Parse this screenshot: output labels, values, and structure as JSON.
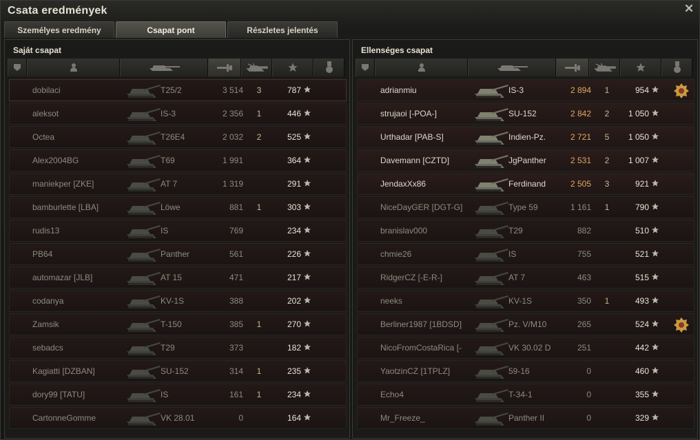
{
  "window": {
    "title": "Csata eredmények"
  },
  "tabs": [
    {
      "label": "Személyes eredmény",
      "active": false
    },
    {
      "label": "Csapat pont",
      "active": true
    },
    {
      "label": "Részletes jelentés",
      "active": false
    }
  ],
  "icons": {
    "close": "close-icon",
    "columns": [
      "tier-icon",
      "player-icon",
      "tank-icon",
      "damage-icon",
      "kills-icon",
      "xp-star-icon",
      "medal-icon"
    ]
  },
  "colors": {
    "accent": "#e0a860",
    "alive_text": "#dedad0",
    "dead_text": "#8e8a80",
    "row_bg": "#2a1c1a"
  },
  "teams": [
    {
      "title": "Saját csapat",
      "players": [
        {
          "name": "dobilaci",
          "tank": "T25/2",
          "damage": "3 514",
          "kills": "3",
          "xp": "787",
          "alive": false,
          "self": true,
          "medal": ""
        },
        {
          "name": "aleksot",
          "tank": "IS-3",
          "damage": "2 356",
          "kills": "1",
          "xp": "446",
          "alive": false,
          "self": false,
          "medal": ""
        },
        {
          "name": "Octea",
          "tank": "T26E4",
          "damage": "2 032",
          "kills": "2",
          "xp": "525",
          "alive": false,
          "self": false,
          "medal": ""
        },
        {
          "name": "Alex2004BG",
          "tank": "T69",
          "damage": "1 991",
          "kills": "",
          "xp": "364",
          "alive": false,
          "self": false,
          "medal": ""
        },
        {
          "name": "maniekper [ZKE]",
          "tank": "AT 7",
          "damage": "1 319",
          "kills": "",
          "xp": "291",
          "alive": false,
          "self": false,
          "medal": ""
        },
        {
          "name": "bamburlette [LBA]",
          "tank": "Löwe",
          "damage": "881",
          "kills": "1",
          "xp": "303",
          "alive": false,
          "self": false,
          "medal": ""
        },
        {
          "name": "rudis13",
          "tank": "IS",
          "damage": "769",
          "kills": "",
          "xp": "234",
          "alive": false,
          "self": false,
          "medal": ""
        },
        {
          "name": "PB64",
          "tank": "Panther",
          "damage": "561",
          "kills": "",
          "xp": "226",
          "alive": false,
          "self": false,
          "medal": ""
        },
        {
          "name": "automazar [JLB]",
          "tank": "AT 15",
          "damage": "471",
          "kills": "",
          "xp": "217",
          "alive": false,
          "self": false,
          "medal": ""
        },
        {
          "name": "codanya",
          "tank": "KV-1S",
          "damage": "388",
          "kills": "",
          "xp": "202",
          "alive": false,
          "self": false,
          "medal": ""
        },
        {
          "name": "Zamsik",
          "tank": "T-150",
          "damage": "385",
          "kills": "1",
          "xp": "270",
          "alive": false,
          "self": false,
          "medal": ""
        },
        {
          "name": "sebadcs",
          "tank": "T29",
          "damage": "373",
          "kills": "",
          "xp": "182",
          "alive": false,
          "self": false,
          "medal": ""
        },
        {
          "name": "Kagiatti [DZBAN]",
          "tank": "SU-152",
          "damage": "314",
          "kills": "1",
          "xp": "235",
          "alive": false,
          "self": false,
          "medal": ""
        },
        {
          "name": "dory99 [TATU]",
          "tank": "IS",
          "damage": "161",
          "kills": "1",
          "xp": "234",
          "alive": false,
          "self": false,
          "medal": ""
        },
        {
          "name": "CartonneGomme",
          "tank": "VK 28.01",
          "damage": "0",
          "kills": "",
          "xp": "164",
          "alive": false,
          "self": false,
          "medal": ""
        }
      ]
    },
    {
      "title": "Ellenséges csapat",
      "players": [
        {
          "name": "adrianmiu",
          "tank": "IS-3",
          "damage": "2 894",
          "kills": "1",
          "xp": "954",
          "alive": true,
          "self": false,
          "medal": "2"
        },
        {
          "name": "strujaoi [-POA-]",
          "tank": "SU-152",
          "damage": "2 842",
          "kills": "2",
          "xp": "1 050",
          "alive": true,
          "self": false,
          "medal": ""
        },
        {
          "name": "Urthadar [PAB-S]",
          "tank": "Indien-Pz.",
          "damage": "2 721",
          "kills": "5",
          "xp": "1 050",
          "alive": true,
          "self": false,
          "medal": ""
        },
        {
          "name": "Davemann [CZTD]",
          "tank": "JgPanther",
          "damage": "2 531",
          "kills": "2",
          "xp": "1 007",
          "alive": true,
          "self": false,
          "medal": ""
        },
        {
          "name": "JendaxXx86",
          "tank": "Ferdinand",
          "damage": "2 505",
          "kills": "3",
          "xp": "921",
          "alive": true,
          "self": false,
          "medal": ""
        },
        {
          "name": "NiceDayGER [DGT-G]",
          "tank": "Type 59",
          "damage": "1 161",
          "kills": "1",
          "xp": "790",
          "alive": false,
          "self": false,
          "medal": ""
        },
        {
          "name": "branislav000",
          "tank": "T29",
          "damage": "882",
          "kills": "",
          "xp": "510",
          "alive": false,
          "self": false,
          "medal": ""
        },
        {
          "name": "chmie26",
          "tank": "IS",
          "damage": "755",
          "kills": "",
          "xp": "521",
          "alive": false,
          "self": false,
          "medal": ""
        },
        {
          "name": "RidgerCZ [-E-R-]",
          "tank": "AT 7",
          "damage": "463",
          "kills": "",
          "xp": "515",
          "alive": false,
          "self": false,
          "medal": ""
        },
        {
          "name": "neeks",
          "tank": "KV-1S",
          "damage": "350",
          "kills": "1",
          "xp": "493",
          "alive": false,
          "self": false,
          "medal": ""
        },
        {
          "name": "Berliner1987 [1BDSD]",
          "tank": "Pz. V/M10",
          "damage": "265",
          "kills": "",
          "xp": "524",
          "alive": false,
          "self": false,
          "medal": ""
        },
        {
          "name": "NicoFromCostaRica [-",
          "tank": "VK 30.02 D",
          "damage": "251",
          "kills": "",
          "xp": "442",
          "alive": false,
          "self": false,
          "medal": ""
        },
        {
          "name": "YaotzinCZ [1TPLZ]",
          "tank": "59-16",
          "damage": "0",
          "kills": "",
          "xp": "460",
          "alive": false,
          "self": false,
          "medal": ""
        },
        {
          "name": "Echo4",
          "tank": "T-34-1",
          "damage": "0",
          "kills": "",
          "xp": "355",
          "alive": false,
          "self": false,
          "medal": ""
        },
        {
          "name": "Mr_Freeze_",
          "tank": "Panther II",
          "damage": "0",
          "kills": "",
          "xp": "329",
          "alive": false,
          "self": false,
          "medal": ""
        }
      ]
    }
  ]
}
